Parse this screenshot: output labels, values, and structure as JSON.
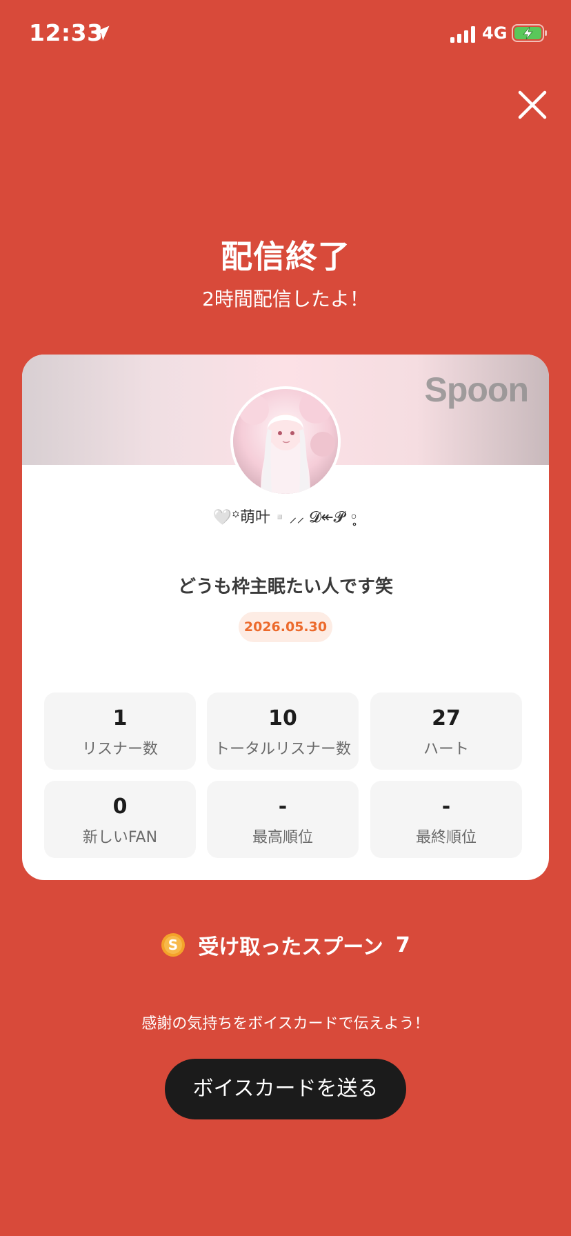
{
  "status_bar": {
    "time": "12:33",
    "network": "4G",
    "icons": [
      "location-arrow-icon",
      "signal-bars-icon",
      "battery-charging-icon"
    ]
  },
  "close_icon": "close-icon",
  "header": {
    "title": "配信終了",
    "subtitle": "2時間配信したよ！"
  },
  "card": {
    "brand": "Spoon",
    "username": "🤍꙳萌叶▫️⸝⸝ 𝓓↞𝓟 ◦̥",
    "stream_title": "どうも枠主眠たい人です笑",
    "date": "2026.05.30",
    "stats": [
      {
        "value": "1",
        "label": "リスナー数"
      },
      {
        "value": "10",
        "label": "トータルリスナー数"
      },
      {
        "value": "27",
        "label": "ハート"
      },
      {
        "value": "0",
        "label": "新しいFAN"
      },
      {
        "value": "-",
        "label": "最高順位"
      },
      {
        "value": "-",
        "label": "最終順位"
      }
    ]
  },
  "spoons": {
    "label": "受け取ったスプーン",
    "count": "7",
    "icon": "spoon-coin-icon",
    "icon_glyph": "S"
  },
  "thanks": "感謝の気持ちをボイスカードで伝えよう！",
  "voice_card_button": "ボイスカードを送る",
  "colors": {
    "background": "#d84a3a",
    "button": "#1b1b1b",
    "date_badge_text": "#ec6a2c",
    "date_badge_bg": "#fdece4",
    "coin": "#f4a32a"
  }
}
